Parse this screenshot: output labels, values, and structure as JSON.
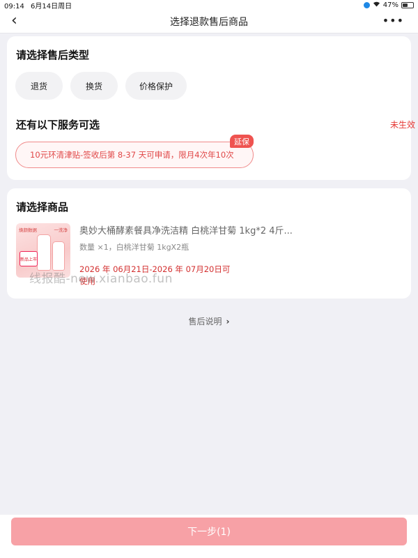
{
  "status_bar": {
    "time": "09:14",
    "date": "6月14日周日",
    "battery": "47%",
    "icons": [
      "location-icon",
      "wifi-icon",
      "battery-icon"
    ]
  },
  "nav": {
    "back_icon": "‹",
    "title": "选择退款售后商品",
    "more_icon": "•••"
  },
  "type_section": {
    "title": "请选择售后类型",
    "options": [
      "退货",
      "换货",
      "价格保护"
    ]
  },
  "service_section": {
    "title": "还有以下服务可选",
    "status": "未生效",
    "badge": "延保",
    "service_text": "10元环清津贴-签收后第 8-37 天可申请，限月4次年10次"
  },
  "goods_section": {
    "title": "请选择商品",
    "product": {
      "name": "奥妙大桶酵素餐具净洗洁精 白桃洋甘菊 1kg*2 4斤...",
      "meta": "数量 ×1，白桃洋甘菊 1kgX2瓶",
      "period": "2026 年 06月21日-2026 年 07月20日可使用",
      "thumb_top_left": "焕颜数据",
      "thumb_top_right": "一洗净",
      "thumb_tag": "新品上市"
    },
    "watermark": "线报酷-new.xianbao.fun"
  },
  "after_sale_link": {
    "label": "售后说明",
    "chevron": "›"
  },
  "footer": {
    "next_label": "下一步(1)"
  },
  "colors": {
    "accent": "#e53935",
    "button_disabled": "#f7a1a6",
    "background": "#f0f0f5"
  }
}
